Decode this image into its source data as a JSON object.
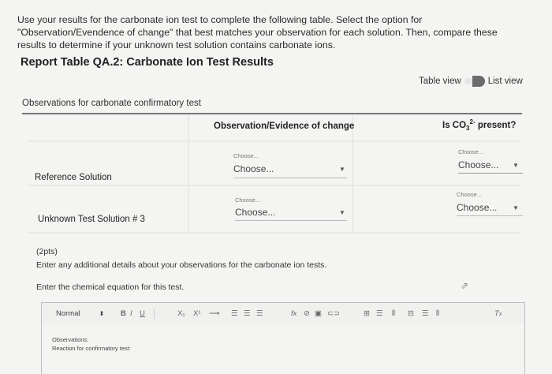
{
  "instructions": "Use your results for the carbonate ion test to complete the following table. Select the option for \"Observation/Evendence of change\" that best matches your observation for each solution. Then, compare these results to determine if your unknown test solution contains carbonate ions.",
  "report_title": "Report Table QA.2: Carbonate Ion Test Results",
  "view_toggle": {
    "table_label": "Table view",
    "list_label": "List view"
  },
  "table": {
    "caption": "Observations for carbonate confirmatory test",
    "col_observation": "Observation/Evidence of change",
    "col_present_prefix": "Is CO",
    "col_present_sub": "3",
    "col_present_sup": "2-",
    "col_present_suffix": " present?",
    "rows": [
      {
        "label": "Reference Solution",
        "obs_small": "Choose...",
        "obs_value": "Choose...",
        "present_small": "Choose...",
        "present_value": "Choose..."
      },
      {
        "label": "Unknown Test Solution # 3",
        "obs_small": "Choose...",
        "obs_value": "Choose...",
        "present_small": "Choose...",
        "present_value": "Choose..."
      }
    ]
  },
  "points": "(2pts)",
  "prompt_details": "Enter any additional details about your observations for the carbonate ion tests.",
  "prompt_equation": "Enter the chemical equation for this test.",
  "toolbar": {
    "style_select": "Normal",
    "bold": "B",
    "italic": "I",
    "underline": "U",
    "subscript": "X₁",
    "superscript": "X¹"
  },
  "editor": {
    "line1": "Observations:",
    "line2": "Reaction for confirmatory test:"
  }
}
